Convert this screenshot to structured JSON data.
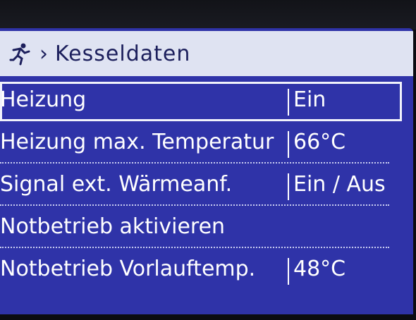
{
  "header": {
    "icon": "running-person-icon",
    "chevron": "›",
    "title": "Kesseldaten"
  },
  "rows": [
    {
      "label": "Heizung",
      "value": "Ein",
      "selected": true
    },
    {
      "label": "Heizung max. Temperatur",
      "value": "66°C"
    },
    {
      "label": "Signal ext. Wärmeanf.",
      "value": "Ein / Aus"
    },
    {
      "label": "Notbetrieb aktivieren",
      "value": ""
    },
    {
      "label": "Notbetrieb Vorlauftemp.",
      "value": "48°C"
    }
  ],
  "colors": {
    "screen_bg": "#2f33a8",
    "header_bg": "#dfe3f2",
    "header_text": "#1c1f5c",
    "row_text": "#ffffff"
  }
}
